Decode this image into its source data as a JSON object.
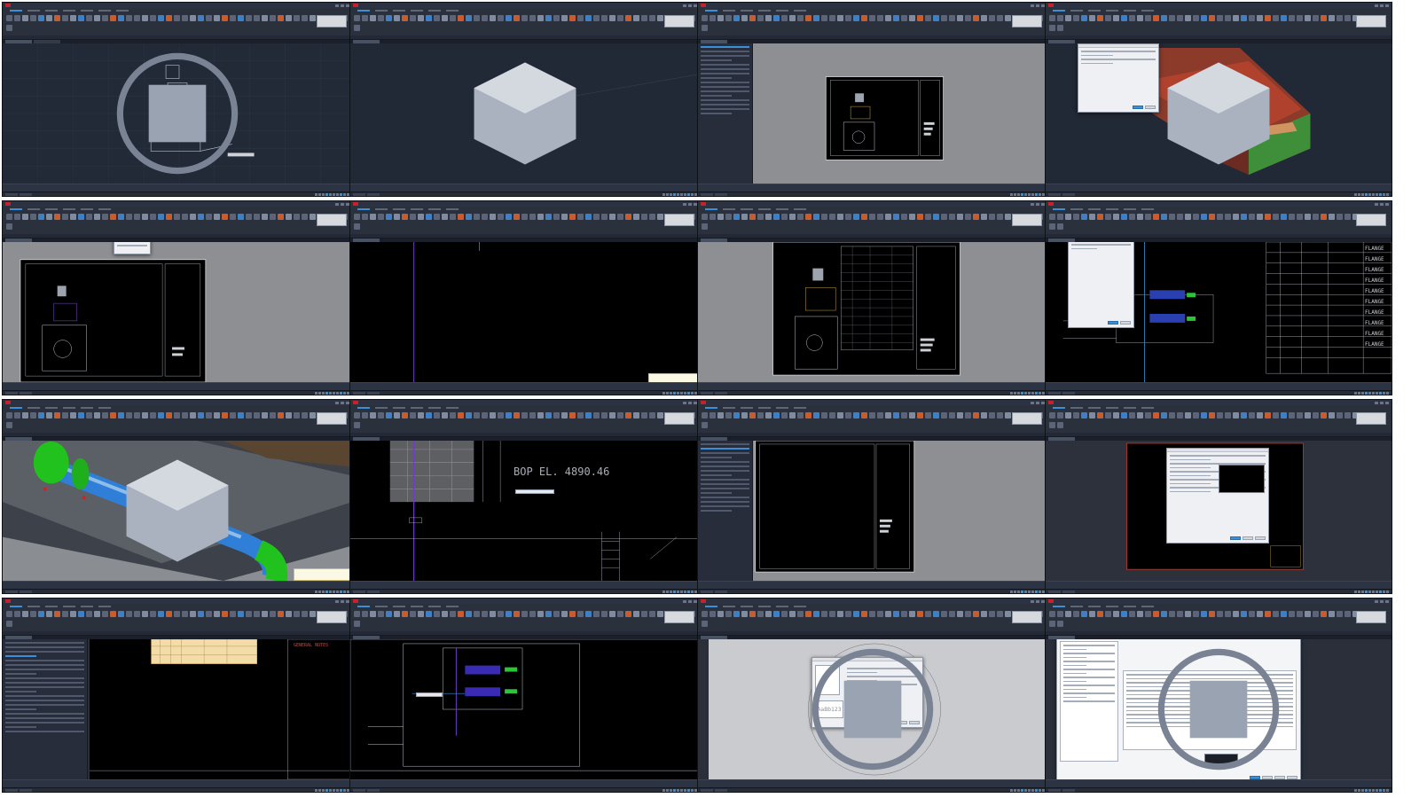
{
  "brand_label": "",
  "tiles": [
    {
      "id": 1,
      "title": "",
      "view": "dark-grid"
    },
    {
      "id": 2,
      "title": "",
      "view": "dark"
    },
    {
      "id": 3,
      "title": "",
      "view": "gray-sheet"
    },
    {
      "id": 4,
      "title": "",
      "view": "3d-model"
    },
    {
      "id": 5,
      "title": "",
      "view": "gray-sheet"
    },
    {
      "id": 6,
      "title": "",
      "view": "black"
    },
    {
      "id": 7,
      "title": "",
      "view": "gray-sheet"
    },
    {
      "id": 8,
      "title": "",
      "view": "black-table"
    },
    {
      "id": 9,
      "title": "",
      "view": "3d-pipe"
    },
    {
      "id": 10,
      "title": "",
      "view": "black-elevation"
    },
    {
      "id": 11,
      "title": "",
      "view": "gray-sheet"
    },
    {
      "id": 12,
      "title": "",
      "view": "dialog"
    },
    {
      "id": 13,
      "title": "",
      "view": "properties"
    },
    {
      "id": 14,
      "title": "",
      "view": "black-plan"
    },
    {
      "id": 15,
      "title": "",
      "view": "textstyle-dialog"
    },
    {
      "id": 16,
      "title": "",
      "view": "spec-dialog"
    }
  ],
  "elevation_label": "BOP EL. 4890.46",
  "general_notes_label": "GENERAL NOTES",
  "sample_text_label": "AaBb123",
  "table8": {
    "rows": [
      [
        "",
        "",
        "",
        "",
        "FLANGE"
      ],
      [
        "",
        "",
        "",
        "",
        "FLANGE"
      ],
      [
        "",
        "",
        "",
        "",
        "FLANGE"
      ],
      [
        "",
        "",
        "",
        "",
        "FLANGE"
      ],
      [
        "",
        "",
        "",
        "",
        "FLANGE"
      ],
      [
        "",
        "",
        "",
        "",
        "FLANGE"
      ],
      [
        "",
        "",
        "",
        "",
        "FLANGE"
      ],
      [
        "",
        "",
        "",
        "",
        "FLANGE"
      ],
      [
        "",
        "",
        "",
        "",
        "FLANGE"
      ],
      [
        "",
        "",
        "",
        "",
        "FLANGE"
      ]
    ]
  },
  "colors": {
    "pipe_green": "#22c21e",
    "pipe_blue": "#2f7fd8",
    "accent": "#3b8fd6",
    "brand_red": "#c8202a"
  }
}
